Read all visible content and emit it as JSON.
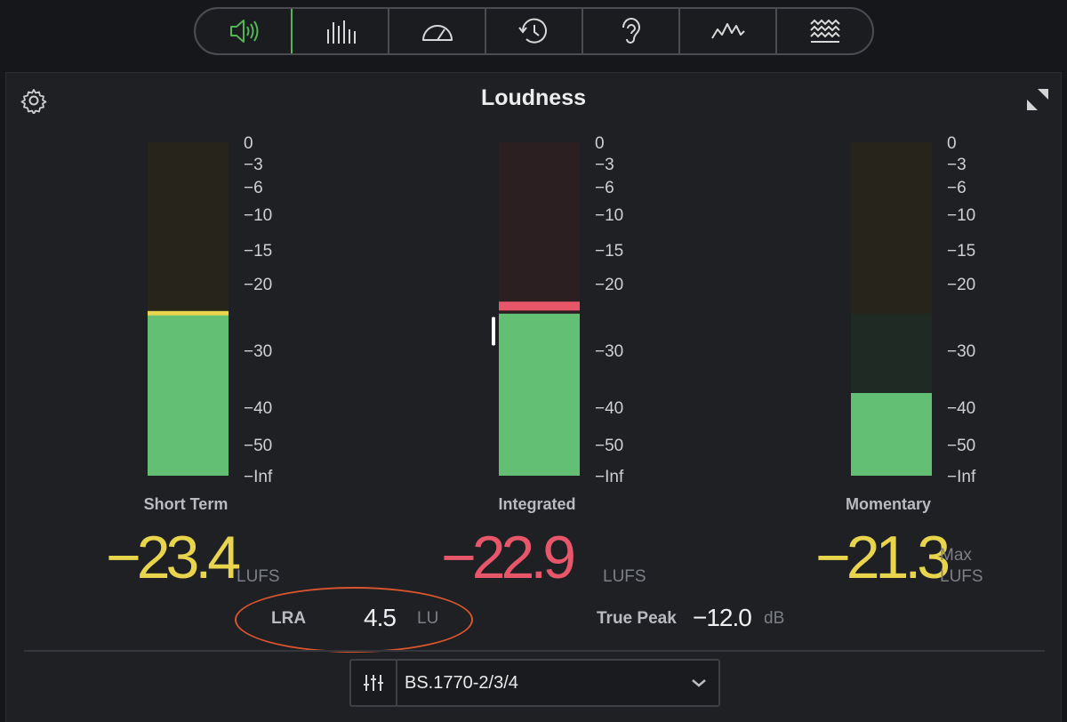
{
  "toolbar": {
    "buttons": [
      {
        "icon": "speaker-icon",
        "active": true
      },
      {
        "icon": "bars-icon",
        "active": false
      },
      {
        "icon": "gauge-icon",
        "active": false
      },
      {
        "icon": "history-icon",
        "active": false
      },
      {
        "icon": "ear-icon",
        "active": false
      },
      {
        "icon": "waveform-icon",
        "active": false
      },
      {
        "icon": "waves-icon",
        "active": false
      }
    ]
  },
  "panel": {
    "title": "Loudness",
    "scale_labels": [
      "0",
      "−3",
      "−6",
      "−10",
      "−15",
      "−20",
      "−30",
      "−40",
      "−50",
      "−Inf"
    ],
    "meters": [
      {
        "name": "Short Term",
        "value": "−23.4",
        "unit": "LUFS",
        "level": -24.5,
        "marker": -24.5,
        "marker_color": "#e8d44d",
        "value_color": "#e8d44d"
      },
      {
        "name": "Integrated",
        "value": "−22.9",
        "unit": "LUFS",
        "level": -24.5,
        "marker": -23.5,
        "marker_color": "#e8566a",
        "value_color": "#e8566a"
      },
      {
        "name": "Momentary",
        "value": "−21.3",
        "unit_top": "Max",
        "unit": "LUFS",
        "level": -37.5,
        "value_color": "#e8d44d"
      }
    ],
    "lra": {
      "label": "LRA",
      "value": "4.5",
      "unit": "LU"
    },
    "true_peak": {
      "label": "True Peak",
      "value": "−12.0",
      "unit": "dB"
    },
    "standard": {
      "selected": "BS.1770-2/3/4"
    }
  },
  "colors": {
    "accent": "#53b556",
    "fill": "#63bf74",
    "yellow": "#e8d44d",
    "red": "#e8566a"
  }
}
